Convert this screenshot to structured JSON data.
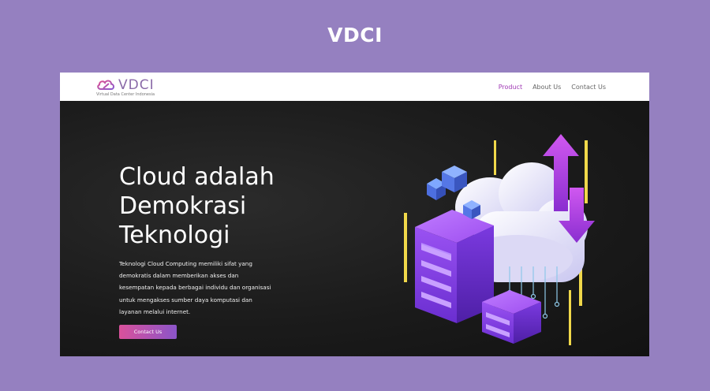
{
  "page": {
    "title": "VDCI"
  },
  "navbar": {
    "logo_text": "VDCI",
    "logo_subtitle": "Virtual Data Center Indonesia",
    "links": [
      {
        "label": "Product",
        "active": true
      },
      {
        "label": "About Us",
        "active": false
      },
      {
        "label": "Contact Us",
        "active": false
      }
    ]
  },
  "hero": {
    "title_lines": [
      "Cloud adalah",
      "Demokrasi",
      "Teknologi"
    ],
    "description_lines": [
      "Teknologi Cloud Computing memiliki sifat yang",
      "demokratis dalam memberikan akses dan",
      "kesempatan kepada berbagai individu dan organisasi",
      "untuk mengakses sumber daya komputasi dan",
      "layanan melalui internet."
    ],
    "cta_label": "Contact Us",
    "illustration": "cloud-server-illustration"
  },
  "colors": {
    "background": "#9580c0",
    "accent": "#a03ab5",
    "button_gradient_start": "#d9519b",
    "button_gradient_end": "#8b55c9",
    "hero_bg": "#1b1b1b"
  }
}
